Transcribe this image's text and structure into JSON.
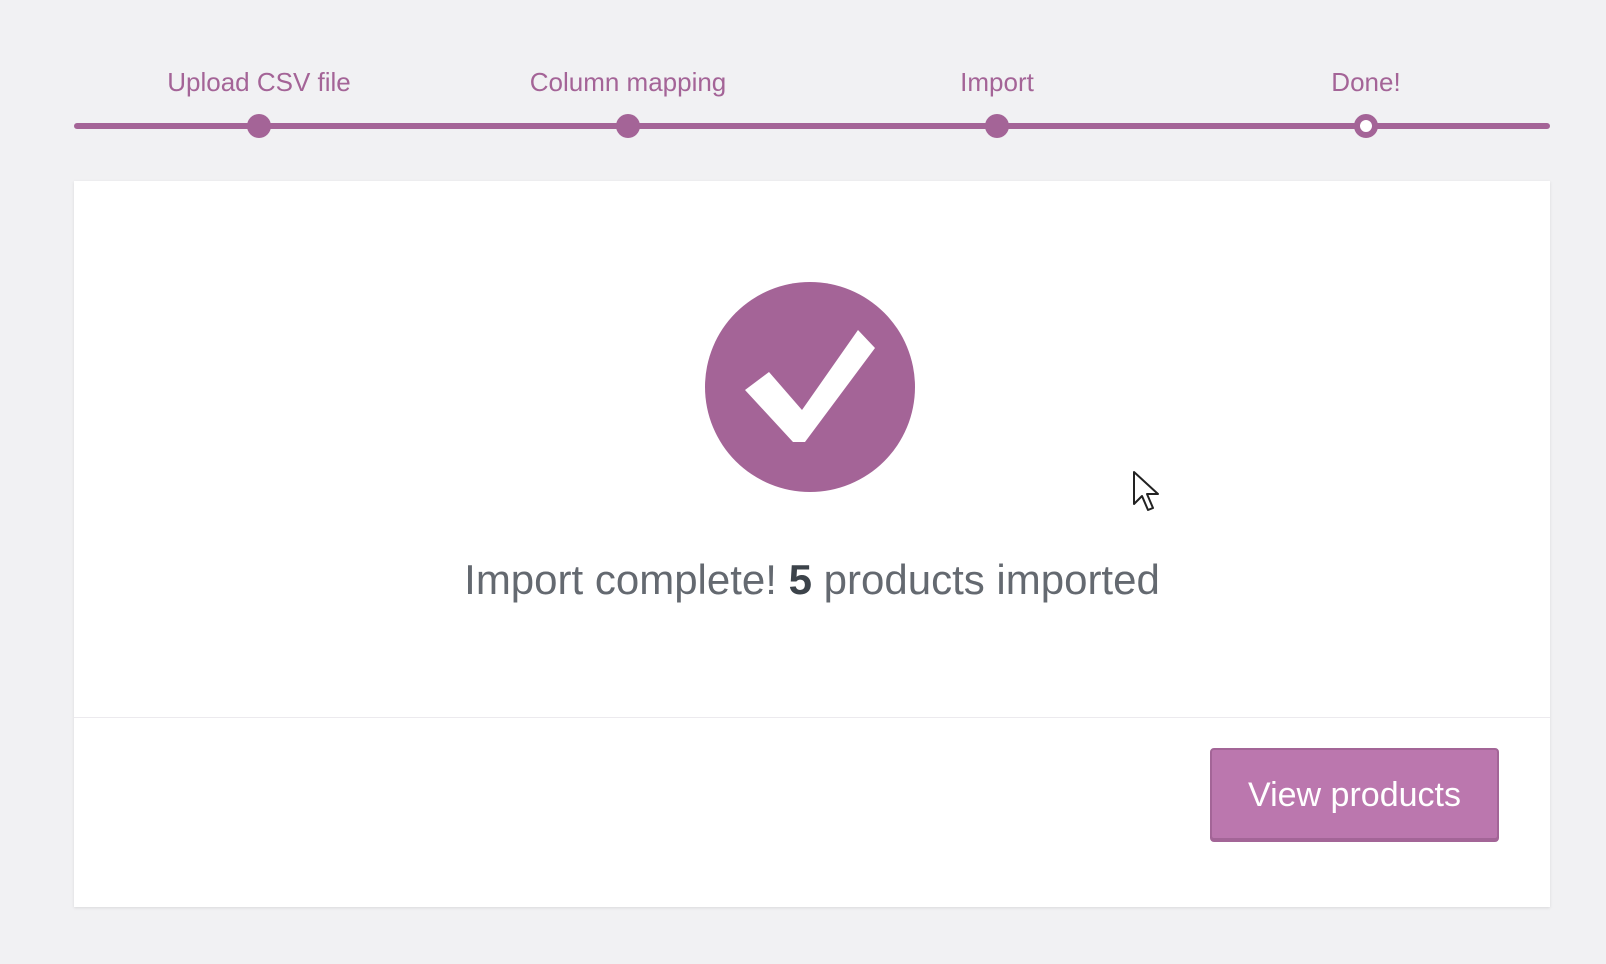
{
  "stepper": {
    "steps": [
      {
        "label": "Upload CSV file",
        "status": "completed"
      },
      {
        "label": "Column mapping",
        "status": "completed"
      },
      {
        "label": "Import",
        "status": "completed"
      },
      {
        "label": "Done!",
        "status": "current"
      }
    ]
  },
  "result": {
    "icon": "checkmark-circle-icon",
    "message_prefix": "Import complete!",
    "count": "5",
    "message_suffix": "products imported"
  },
  "footer": {
    "view_products_label": "View products"
  },
  "colors": {
    "accent": "#a46497",
    "button_bg": "#bb77ae",
    "background": "#f1f1f3",
    "card": "#ffffff",
    "text": "#646970"
  }
}
